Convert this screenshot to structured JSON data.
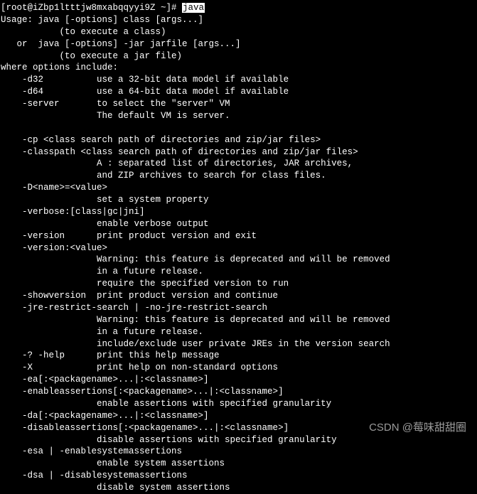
{
  "prompt": {
    "user_host": "[root@iZbp1ltttjw8mxabqqyyi9Z ~]# ",
    "command": "java"
  },
  "lines": [
    "Usage: java [-options] class [args...]",
    "           (to execute a class)",
    "   or  java [-options] -jar jarfile [args...]",
    "           (to execute a jar file)",
    "where options include:",
    "    -d32          use a 32-bit data model if available",
    "    -d64          use a 64-bit data model if available",
    "    -server       to select the \"server\" VM",
    "                  The default VM is server.",
    "",
    "    -cp <class search path of directories and zip/jar files>",
    "    -classpath <class search path of directories and zip/jar files>",
    "                  A : separated list of directories, JAR archives,",
    "                  and ZIP archives to search for class files.",
    "    -D<name>=<value>",
    "                  set a system property",
    "    -verbose:[class|gc|jni]",
    "                  enable verbose output",
    "    -version      print product version and exit",
    "    -version:<value>",
    "                  Warning: this feature is deprecated and will be removed",
    "                  in a future release.",
    "                  require the specified version to run",
    "    -showversion  print product version and continue",
    "    -jre-restrict-search | -no-jre-restrict-search",
    "                  Warning: this feature is deprecated and will be removed",
    "                  in a future release.",
    "                  include/exclude user private JREs in the version search",
    "    -? -help      print this help message",
    "    -X            print help on non-standard options",
    "    -ea[:<packagename>...|:<classname>]",
    "    -enableassertions[:<packagename>...|:<classname>]",
    "                  enable assertions with specified granularity",
    "    -da[:<packagename>...|:<classname>]",
    "    -disableassertions[:<packagename>...|:<classname>]",
    "                  disable assertions with specified granularity",
    "    -esa | -enablesystemassertions",
    "                  enable system assertions",
    "    -dsa | -disablesystemassertions",
    "                  disable system assertions"
  ],
  "watermark": "CSDN @莓味甜甜圈"
}
